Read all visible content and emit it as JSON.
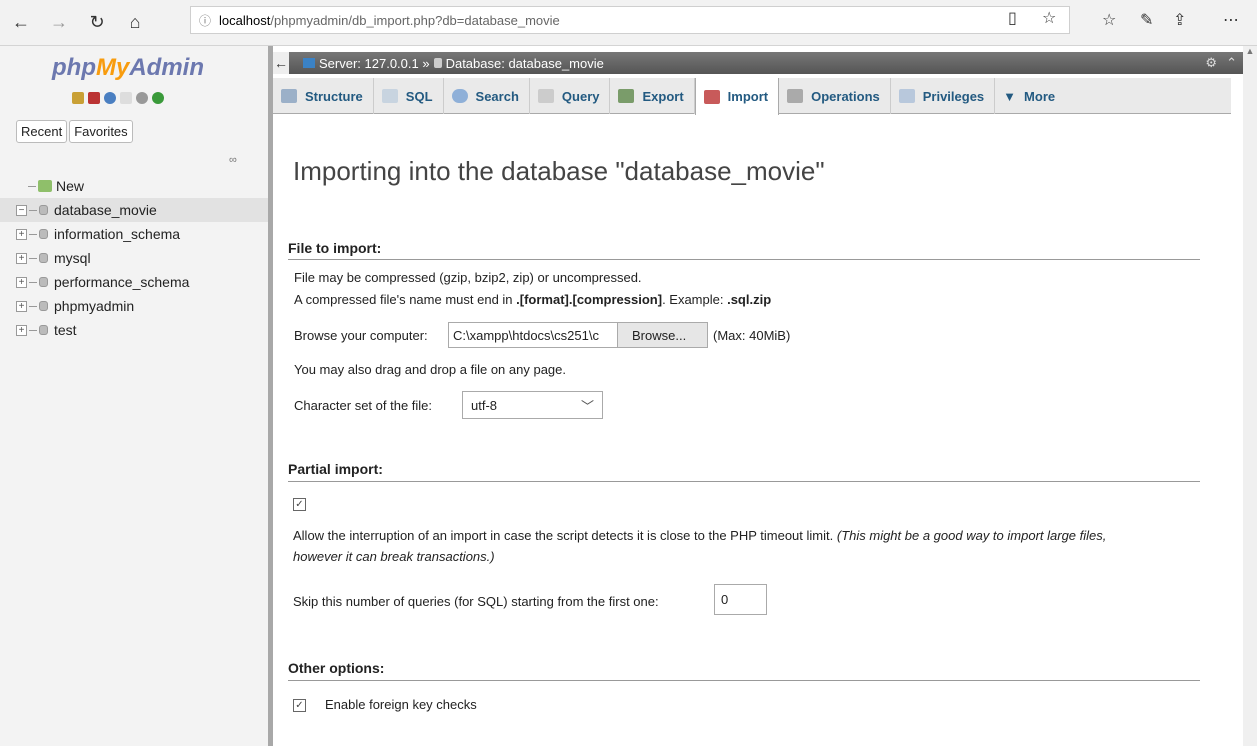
{
  "browser": {
    "url_host": "localhost",
    "url_path": "/phpmyadmin/db_import.php?db=database_movie"
  },
  "sidebar": {
    "logo": {
      "php": "php",
      "my": "My",
      "admin": "Admin"
    },
    "tabs": [
      "Recent",
      "Favorites"
    ],
    "tree": [
      {
        "label": "New"
      },
      {
        "label": "database_movie"
      },
      {
        "label": "information_schema"
      },
      {
        "label": "mysql"
      },
      {
        "label": "performance_schema"
      },
      {
        "label": "phpmyadmin"
      },
      {
        "label": "test"
      }
    ]
  },
  "breadcrumb": {
    "server": "Server: 127.0.0.1 »",
    "database": "Database: database_movie"
  },
  "tabs": [
    "Structure",
    "SQL",
    "Search",
    "Query",
    "Export",
    "Import",
    "Operations",
    "Privileges",
    "More"
  ],
  "page": {
    "title": "Importing into the database \"database_movie\"",
    "file_section": {
      "heading": "File to import:",
      "line1": "File may be compressed (gzip, bzip2, zip) or uncompressed.",
      "line2_prefix": "A compressed file's name must end in ",
      "line2_bold": ".[format].[compression]",
      "line2_mid": ". Example: ",
      "line2_example": ".sql.zip",
      "browse_label": "Browse your computer:",
      "file_path": "C:\\xampp\\htdocs\\cs251\\c",
      "browse_button": "Browse...",
      "max_size": "(Max: 40MiB)",
      "drag_text": "You may also drag and drop a file on any page.",
      "charset_label": "Character set of the file:",
      "charset_value": "utf-8"
    },
    "partial_section": {
      "heading": "Partial import:",
      "allow_text": "Allow the interruption of an import in case the script detects it is close to the PHP timeout limit.",
      "allow_italic_1": "(This might be a good way to import large files,",
      "allow_italic_2": "however it can break transactions.)",
      "skip_label": "Skip this number of queries (for SQL) starting from the first one:",
      "skip_value": "0"
    },
    "other_section": {
      "heading": "Other options:",
      "foreign_key": "Enable foreign key checks"
    }
  },
  "colors": {
    "tab_text": "#235a81",
    "logo_blue": "#6c78af",
    "logo_orange": "#f89c0e"
  }
}
